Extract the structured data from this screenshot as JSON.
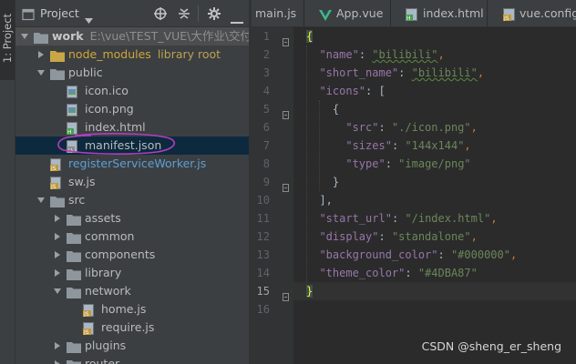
{
  "side_strip": {
    "label": "1: Project"
  },
  "panel": {
    "title": "Project",
    "tree": [
      {
        "name": "work",
        "path": "E:\\vue\\TEST_VUE\\大作业\\交付大作业",
        "type": "folder",
        "expanded": true,
        "depth": 0,
        "bold": true
      },
      {
        "name": "node_modules",
        "extra": "library root",
        "type": "folder-lib",
        "expanded": false,
        "depth": 1
      },
      {
        "name": "public",
        "type": "folder",
        "expanded": true,
        "depth": 1
      },
      {
        "name": "icon.ico",
        "type": "file-img",
        "depth": 2
      },
      {
        "name": "icon.png",
        "type": "file-img",
        "depth": 2
      },
      {
        "name": "index.html",
        "type": "file-html",
        "depth": 2
      },
      {
        "name": "manifest.json",
        "type": "file-json",
        "depth": 2,
        "selected": true
      },
      {
        "name": "registerServiceWorker.js",
        "type": "file-js",
        "depth": 1
      },
      {
        "name": "sw.js",
        "type": "file-js",
        "depth": 1
      },
      {
        "name": "src",
        "type": "folder",
        "expanded": true,
        "depth": 1
      },
      {
        "name": "assets",
        "type": "folder",
        "expanded": false,
        "depth": 2
      },
      {
        "name": "common",
        "type": "folder",
        "expanded": false,
        "depth": 2
      },
      {
        "name": "components",
        "type": "folder",
        "expanded": false,
        "depth": 2
      },
      {
        "name": "library",
        "type": "folder",
        "expanded": false,
        "depth": 2
      },
      {
        "name": "network",
        "type": "folder",
        "expanded": true,
        "depth": 2
      },
      {
        "name": "home.js",
        "type": "file-js",
        "depth": 3
      },
      {
        "name": "require.js",
        "type": "file-js",
        "depth": 3
      },
      {
        "name": "plugins",
        "type": "folder",
        "expanded": false,
        "depth": 2
      },
      {
        "name": "router",
        "type": "folder",
        "expanded": false,
        "depth": 2
      }
    ]
  },
  "tabs": [
    {
      "label": "main.js",
      "icon": "js-file-icon"
    },
    {
      "label": "App.vue",
      "icon": "vue-file-icon"
    },
    {
      "label": "index.html",
      "icon": "html-file-icon"
    },
    {
      "label": "vue.config",
      "icon": "js-file-icon"
    }
  ],
  "editor": {
    "current_line": 15,
    "lines": [
      [
        [
          "{",
          "hl"
        ]
      ],
      [
        [
          "  ",
          ""
        ],
        [
          "\"name\"",
          "k"
        ],
        [
          ": ",
          "b"
        ],
        [
          "\"bilibili\"",
          "s-sq"
        ],
        [
          ",",
          "p"
        ]
      ],
      [
        [
          "  ",
          ""
        ],
        [
          "\"short_name\"",
          "k"
        ],
        [
          ": ",
          "b"
        ],
        [
          "\"bilibili\"",
          "s-sq"
        ],
        [
          ",",
          "p"
        ]
      ],
      [
        [
          "  ",
          ""
        ],
        [
          "\"icons\"",
          "k"
        ],
        [
          ": [",
          "b"
        ]
      ],
      [
        [
          "    {",
          "b"
        ]
      ],
      [
        [
          "      ",
          ""
        ],
        [
          "\"src\"",
          "k"
        ],
        [
          ": ",
          "b"
        ],
        [
          "\"./icon.png\"",
          "s"
        ],
        [
          ",",
          "p"
        ]
      ],
      [
        [
          "      ",
          ""
        ],
        [
          "\"sizes\"",
          "k"
        ],
        [
          ": ",
          "b"
        ],
        [
          "\"144x144\"",
          "s"
        ],
        [
          ",",
          "p"
        ]
      ],
      [
        [
          "      ",
          ""
        ],
        [
          "\"type\"",
          "k"
        ],
        [
          ": ",
          "b"
        ],
        [
          "\"image/png\"",
          "s"
        ]
      ],
      [
        [
          "    }",
          "b"
        ]
      ],
      [
        [
          "  ],",
          "b"
        ]
      ],
      [
        [
          "  ",
          ""
        ],
        [
          "\"start_url\"",
          "k"
        ],
        [
          ": ",
          "b"
        ],
        [
          "\"/index.html\"",
          "s"
        ],
        [
          ",",
          "p"
        ]
      ],
      [
        [
          "  ",
          ""
        ],
        [
          "\"display\"",
          "k"
        ],
        [
          ": ",
          "b"
        ],
        [
          "\"standalone\"",
          "s"
        ],
        [
          ",",
          "p"
        ]
      ],
      [
        [
          "  ",
          ""
        ],
        [
          "\"background_color\"",
          "k"
        ],
        [
          ": ",
          "b"
        ],
        [
          "\"#000000\"",
          "s"
        ],
        [
          ",",
          "p"
        ]
      ],
      [
        [
          "  ",
          ""
        ],
        [
          "\"theme_color\"",
          "k"
        ],
        [
          ": ",
          "b"
        ],
        [
          "\"#4DBA87\"",
          "s"
        ]
      ],
      [
        [
          "}",
          "hl"
        ]
      ],
      []
    ]
  },
  "watermark": "CSDN @sheng_er_sheng",
  "colors": {
    "panel_bg": "#3c3f41",
    "editor_bg": "#2b2b2b",
    "selection": "#0d293e",
    "key": "#9876aa",
    "string": "#6a8759",
    "annotation": "#b03ec0"
  }
}
